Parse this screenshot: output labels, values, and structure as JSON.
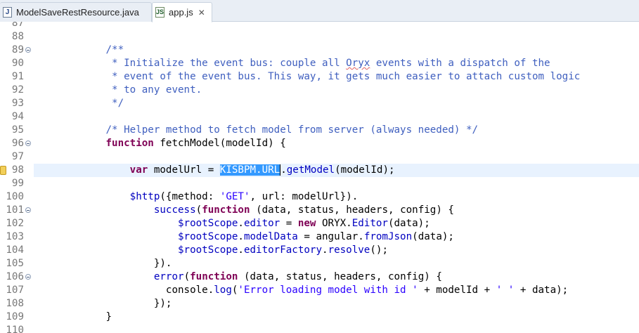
{
  "tabs": [
    {
      "label": "ModelSaveRestResource.java",
      "icon": "java-file-icon",
      "icon_glyph": "J",
      "active": false
    },
    {
      "label": "app.js",
      "icon": "js-file-icon",
      "icon_glyph": "JS",
      "active": true,
      "close": "✕"
    }
  ],
  "colors": {
    "keyword": "#7f0055",
    "comment": "#3f5fbf",
    "string": "#2a00ff",
    "current_line": "#e8f2fe",
    "selection": "#3399ff"
  },
  "editor": {
    "current_line": 98,
    "lines": [
      {
        "n": "87",
        "tokens": []
      },
      {
        "n": "88",
        "tokens": []
      },
      {
        "n": "89",
        "fold": true,
        "tokens": [
          {
            "t": "            "
          },
          {
            "t": "/**",
            "c": "c"
          }
        ]
      },
      {
        "n": "90",
        "tokens": [
          {
            "t": "             "
          },
          {
            "t": "* Initialize the event bus: couple all ",
            "c": "c"
          },
          {
            "t": "Oryx",
            "c": "c sq"
          },
          {
            "t": " events with a dispatch of the",
            "c": "c"
          }
        ]
      },
      {
        "n": "91",
        "tokens": [
          {
            "t": "             "
          },
          {
            "t": "* event of the event bus. This way, it gets much easier to attach custom logic",
            "c": "c"
          }
        ]
      },
      {
        "n": "92",
        "tokens": [
          {
            "t": "             "
          },
          {
            "t": "* to any event.",
            "c": "c"
          }
        ]
      },
      {
        "n": "93",
        "tokens": [
          {
            "t": "             "
          },
          {
            "t": "*/",
            "c": "c"
          }
        ]
      },
      {
        "n": "94",
        "tokens": []
      },
      {
        "n": "95",
        "tokens": [
          {
            "t": "            "
          },
          {
            "t": "/* Helper method to fetch model from server (always needed) */",
            "c": "c"
          }
        ]
      },
      {
        "n": "96",
        "fold": true,
        "tokens": [
          {
            "t": "            "
          },
          {
            "t": "function",
            "c": "k"
          },
          {
            "t": " fetchModel(modelId) {"
          }
        ]
      },
      {
        "n": "97",
        "tokens": []
      },
      {
        "n": "98",
        "marker": true,
        "tokens": [
          {
            "t": "                "
          },
          {
            "t": "var",
            "c": "k"
          },
          {
            "t": " modelUrl = "
          },
          {
            "t": "KISBPM.URL",
            "c": "sel"
          },
          {
            "caret": true
          },
          {
            "t": "."
          },
          {
            "t": "getModel",
            "c": "cn"
          },
          {
            "t": "(modelId);"
          }
        ]
      },
      {
        "n": "99",
        "tokens": []
      },
      {
        "n": "100",
        "tokens": [
          {
            "t": "                "
          },
          {
            "t": "$http",
            "c": "cn"
          },
          {
            "t": "({method: "
          },
          {
            "t": "'GET'",
            "c": "s"
          },
          {
            "t": ", url: modelUrl})."
          }
        ]
      },
      {
        "n": "101",
        "fold": true,
        "tokens": [
          {
            "t": "                    "
          },
          {
            "t": "success",
            "c": "cn"
          },
          {
            "t": "("
          },
          {
            "t": "function",
            "c": "k"
          },
          {
            "t": " (data, status, headers, config) {"
          }
        ]
      },
      {
        "n": "102",
        "tokens": [
          {
            "t": "                        "
          },
          {
            "t": "$rootScope",
            "c": "cn"
          },
          {
            "t": "."
          },
          {
            "t": "editor",
            "c": "cn"
          },
          {
            "t": " = "
          },
          {
            "t": "new",
            "c": "k"
          },
          {
            "t": " ORYX."
          },
          {
            "t": "Editor",
            "c": "cn"
          },
          {
            "t": "(data);"
          }
        ]
      },
      {
        "n": "103",
        "tokens": [
          {
            "t": "                        "
          },
          {
            "t": "$rootScope",
            "c": "cn"
          },
          {
            "t": "."
          },
          {
            "t": "modelData",
            "c": "cn"
          },
          {
            "t": " = angular."
          },
          {
            "t": "fromJson",
            "c": "cn"
          },
          {
            "t": "(data);"
          }
        ]
      },
      {
        "n": "104",
        "tokens": [
          {
            "t": "                        "
          },
          {
            "t": "$rootScope",
            "c": "cn"
          },
          {
            "t": "."
          },
          {
            "t": "editorFactory",
            "c": "cn"
          },
          {
            "t": "."
          },
          {
            "t": "resolve",
            "c": "cn"
          },
          {
            "t": "();"
          }
        ]
      },
      {
        "n": "105",
        "tokens": [
          {
            "t": "                    })."
          }
        ]
      },
      {
        "n": "106",
        "fold": true,
        "tokens": [
          {
            "t": "                    "
          },
          {
            "t": "error",
            "c": "cn"
          },
          {
            "t": "("
          },
          {
            "t": "function",
            "c": "k"
          },
          {
            "t": " (data, status, headers, config) {"
          }
        ]
      },
      {
        "n": "107",
        "tokens": [
          {
            "t": "                      console."
          },
          {
            "t": "log",
            "c": "cn"
          },
          {
            "t": "("
          },
          {
            "t": "'Error loading model with id '",
            "c": "s"
          },
          {
            "t": " + modelId + "
          },
          {
            "t": "' '",
            "c": "s"
          },
          {
            "t": " + data);"
          }
        ]
      },
      {
        "n": "108",
        "tokens": [
          {
            "t": "                    });"
          }
        ]
      },
      {
        "n": "109",
        "tokens": [
          {
            "t": "            }"
          }
        ]
      },
      {
        "n": "110",
        "tokens": []
      }
    ]
  }
}
